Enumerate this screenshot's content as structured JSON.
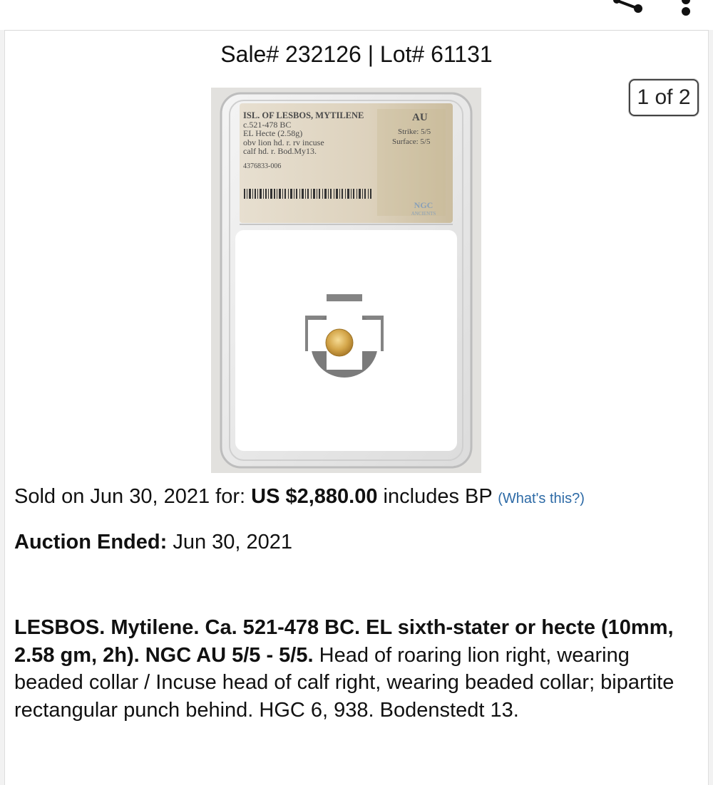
{
  "header": {
    "share_icon": "share-icon",
    "more_icon": "more-vertical-icon"
  },
  "lot": {
    "title": "Sale# 232126 | Lot# 61131",
    "image_counter": "1 of 2"
  },
  "slab_label": {
    "line1": "ISL. OF LESBOS, MYTILENE",
    "line2": "c.521-478 BC",
    "line3": "EL Hecte (2.58g)",
    "line4": "obv lion hd. r. rv incuse",
    "line5": "calf hd. r. Bod.My13.",
    "cert_number": "4376833-006",
    "grade": "AU",
    "strike": "Strike: 5/5",
    "surface": "Surface: 5/5",
    "logo_text": "NGC",
    "logo_subtext": "ANCIENTS"
  },
  "sale": {
    "sold_prefix": "Sold on Jun 30, 2021 for: ",
    "price": "US $2,880.00",
    "suffix": " includes BP ",
    "whats_this": "(What's this?)",
    "ended_label": "Auction Ended:",
    "ended_date": " Jun 30, 2021"
  },
  "description": {
    "bold": "LESBOS. Mytilene. Ca. 521-478 BC. EL sixth-stater or hecte (10mm, 2.58 gm, 2h). NGC AU 5/5 - 5/5.",
    "text": " Head of roaring lion right, wearing beaded collar / Incuse head of calf right, wearing beaded collar; bipartite rectangular punch behind. HGC 6, 938. Bodenstedt 13."
  },
  "colors": {
    "link": "#2d6aa6",
    "label_bg": "#d9cfbd",
    "coin_gold": "#d4a64a"
  }
}
